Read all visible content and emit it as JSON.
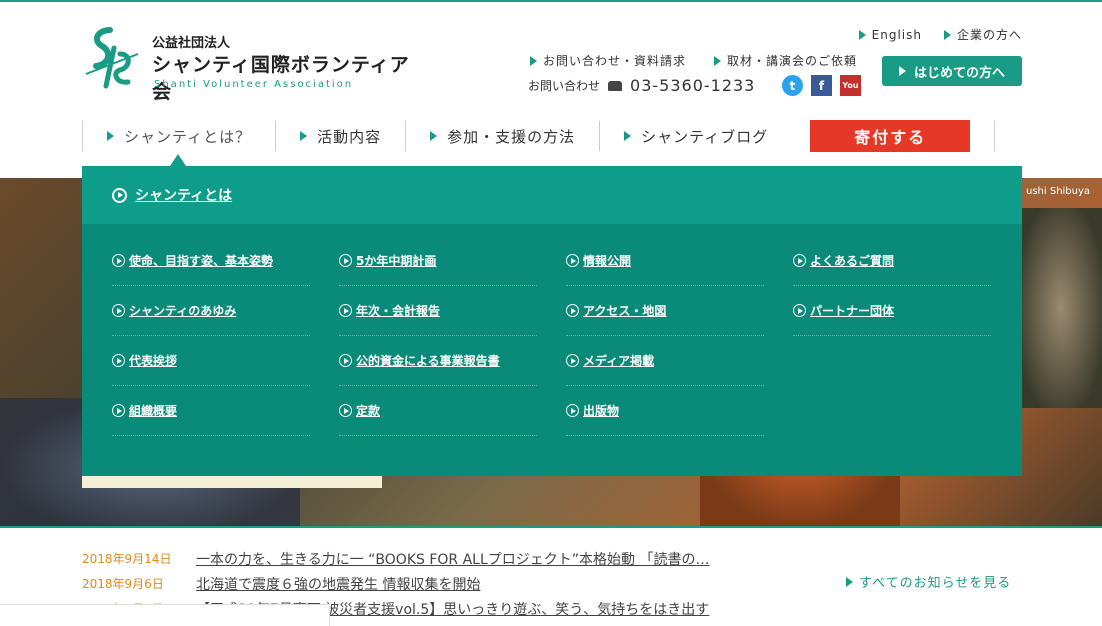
{
  "header": {
    "org_type": "公益社団法人",
    "org_name": "シャンティ国際ボランティア会",
    "org_name_en": "Shanti Volunteer Association",
    "links_top": [
      {
        "label": "English"
      },
      {
        "label": "企業の方へ"
      }
    ],
    "links_mid": [
      {
        "label": "お問い合わせ・資料請求"
      },
      {
        "label": "取材・講演会のご依頼"
      }
    ],
    "phone_label": "お問い合わせ",
    "phone_number": "03-5360-1233",
    "first_visit_label": "はじめての方へ",
    "social": [
      {
        "icon": "twitter-icon",
        "glyph": "t"
      },
      {
        "icon": "facebook-icon",
        "glyph": "f"
      },
      {
        "icon": "youtube-icon",
        "glyph": "You"
      }
    ]
  },
  "nav": {
    "items": [
      {
        "label": "シャンティとは？"
      },
      {
        "label": "活動内容"
      },
      {
        "label": "参加・支援の方法"
      },
      {
        "label": "シャンティブログ"
      }
    ],
    "donate_label": "寄付する"
  },
  "hero": {
    "credit": "ushi Shibuya"
  },
  "mega_menu": {
    "title": "シャンティとは",
    "items": [
      {
        "label": "使命、目指す姿、基本姿勢"
      },
      {
        "label": "5か年中期計画"
      },
      {
        "label": "情報公開"
      },
      {
        "label": "よくあるご質問"
      },
      {
        "label": "シャンティのあゆみ"
      },
      {
        "label": "年次・会計報告"
      },
      {
        "label": "アクセス・地図"
      },
      {
        "label": "パートナー団体"
      },
      {
        "label": "代表挨拶"
      },
      {
        "label": "公的資金による事業報告書"
      },
      {
        "label": "メディア掲載"
      },
      {
        "label": ""
      },
      {
        "label": "組織概要"
      },
      {
        "label": "定款"
      },
      {
        "label": "出版物"
      },
      {
        "label": ""
      }
    ]
  },
  "news": {
    "items": [
      {
        "date": "2018年9月14日",
        "title": "一本の力を、生きる力に一 “BOOKS FOR ALLプロジェクト”本格始動 「読書の…"
      },
      {
        "date": "2018年9月6日",
        "title": "北海道で震度６強の地震発生 情報収集を開始"
      },
      {
        "date": "2018年9月5日",
        "title": "【平成30年7月豪雨 被災者支援vol.5】思いっきり遊ぶ、笑う、気持ちをはき出す"
      }
    ],
    "all_label": "すべてのお知らせを見る"
  },
  "colors": {
    "brand": "#1a9b85",
    "menu_bg": "#0a8a78",
    "donate": "#e53826",
    "news_date": "#e08a1e"
  }
}
